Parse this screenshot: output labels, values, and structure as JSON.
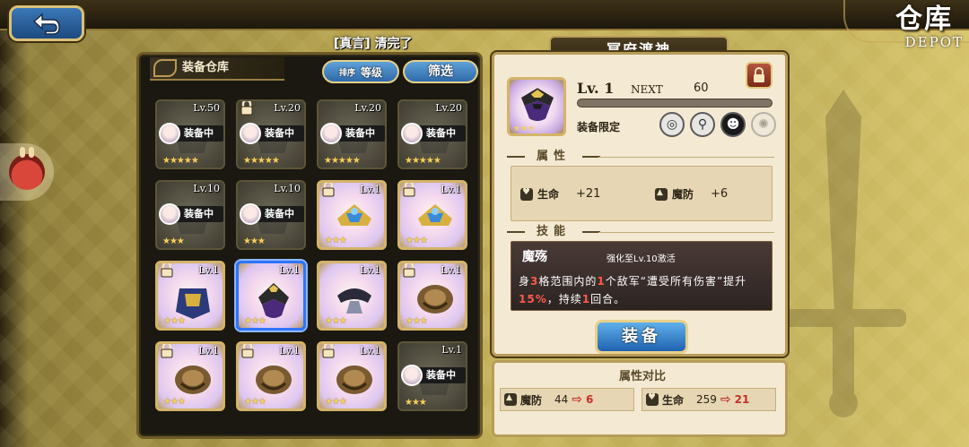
{
  "header": {
    "back_icon": "back-arrow-icon",
    "depot_zh": "仓库",
    "depot_en": "DEPOT"
  },
  "left": {
    "top_title": "[真言] 清完了",
    "header_label": "装备仓库",
    "sort_label": "排序",
    "sort_value": "等级",
    "filter_label": "筛选",
    "slots": [
      {
        "lv": "Lv.50",
        "locked": false,
        "equipped": true,
        "tag": "装备中",
        "dim": true,
        "stars": "★★★★★"
      },
      {
        "lv": "Lv.20",
        "locked": true,
        "equipped": true,
        "tag": "装备中",
        "dim": true,
        "stars": "★★★★★"
      },
      {
        "lv": "Lv.20",
        "locked": false,
        "equipped": true,
        "tag": "装备中",
        "dim": true,
        "stars": "★★★★★"
      },
      {
        "lv": "Lv.20",
        "locked": false,
        "equipped": true,
        "tag": "装备中",
        "dim": true,
        "stars": "★★★★★"
      },
      {
        "lv": "Lv.10",
        "locked": false,
        "equipped": true,
        "tag": "装备中",
        "dim": true,
        "stars": "★★★"
      },
      {
        "lv": "Lv.10",
        "locked": false,
        "equipped": true,
        "tag": "装备中",
        "dim": true,
        "stars": "★★★"
      },
      {
        "lv": "Lv.1",
        "locked": true,
        "equipped": false,
        "tag": "",
        "dim": false,
        "stars": "★★★"
      },
      {
        "lv": "Lv.1",
        "locked": true,
        "equipped": false,
        "tag": "",
        "dim": false,
        "stars": "★★★"
      },
      {
        "lv": "Lv.1",
        "locked": true,
        "equipped": false,
        "tag": "",
        "dim": false,
        "stars": "★★★"
      },
      {
        "lv": "Lv.1",
        "locked": false,
        "equipped": false,
        "tag": "",
        "dim": false,
        "stars": "★★★",
        "selected": true
      },
      {
        "lv": "Lv.1",
        "locked": false,
        "equipped": false,
        "tag": "",
        "dim": false,
        "stars": "★★★"
      },
      {
        "lv": "Lv.1",
        "locked": true,
        "equipped": false,
        "tag": "",
        "dim": false,
        "stars": "★★★"
      },
      {
        "lv": "Lv.1",
        "locked": true,
        "equipped": false,
        "tag": "",
        "dim": false,
        "stars": "★★★"
      },
      {
        "lv": "Lv.1",
        "locked": true,
        "equipped": false,
        "tag": "",
        "dim": false,
        "stars": "★★★"
      },
      {
        "lv": "Lv.1",
        "locked": true,
        "equipped": false,
        "tag": "",
        "dim": false,
        "stars": "★★★"
      },
      {
        "lv": "Lv.1",
        "locked": false,
        "equipped": true,
        "tag": "装备中",
        "dim": true,
        "stars": "★★★"
      }
    ]
  },
  "detail": {
    "title": "冥府渡神",
    "level": "Lv. 1",
    "next_label": "NEXT",
    "next_value": "60",
    "restrict_label": "装备限定",
    "attr_header": "属性",
    "hp_label": "生命",
    "hp_value": "+21",
    "def_label": "魔防",
    "def_value": "+6",
    "skill_header": "技能",
    "skill_name": "魔殇",
    "skill_hint": "强化至Lv.10激活",
    "skill_desc_1": "身",
    "skill_desc_num1": "3",
    "skill_desc_2": "格范围内的",
    "skill_desc_num2": "1",
    "skill_desc_3": "个敌军“遭受所有伤害”提升",
    "skill_desc_num3": "15%",
    "skill_desc_4": "，持续",
    "skill_desc_num4": "1",
    "skill_desc_5": "回合。",
    "equip_label": "装备"
  },
  "compare": {
    "header": "属性对比",
    "def_label": "魔防",
    "def_from": "44",
    "def_to": "6",
    "hp_label": "生命",
    "hp_from": "259",
    "hp_to": "21"
  }
}
